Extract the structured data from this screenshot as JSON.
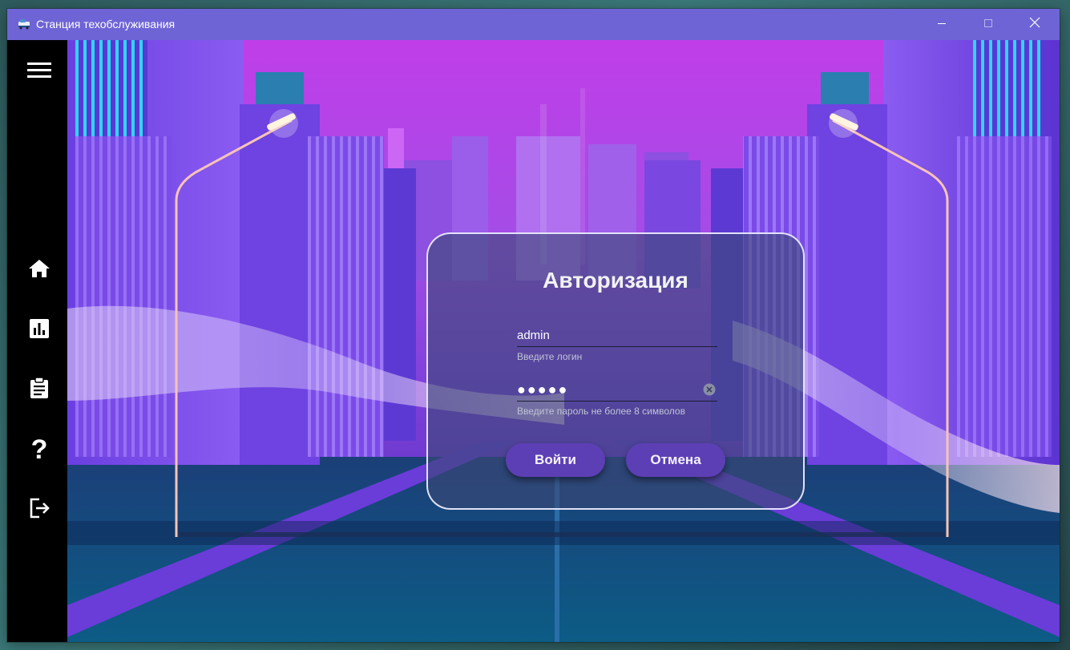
{
  "window": {
    "title": "Станция техобслуживания",
    "controls": {
      "minimize": "minimize-icon",
      "maximize": "maximize-icon",
      "close": "close-icon"
    }
  },
  "sidebar": {
    "items": [
      {
        "icon": "hamburger-menu-icon"
      },
      {
        "icon": "home-icon"
      },
      {
        "icon": "bar-chart-icon"
      },
      {
        "icon": "clipboard-icon"
      },
      {
        "icon": "help-icon",
        "glyph": "?"
      },
      {
        "icon": "exit-icon"
      }
    ]
  },
  "dialog": {
    "title": "Авторизация",
    "login": {
      "value": "admin",
      "hint": "Введите логин"
    },
    "password": {
      "value": "●●●●●",
      "hint": "Введите пароль не более 8 символов"
    },
    "buttons": {
      "login": "Войти",
      "cancel": "Отмена"
    }
  },
  "colors": {
    "titlebar": "#6e64d6",
    "sidebar": "#000000",
    "button": "#5d3fb5"
  }
}
